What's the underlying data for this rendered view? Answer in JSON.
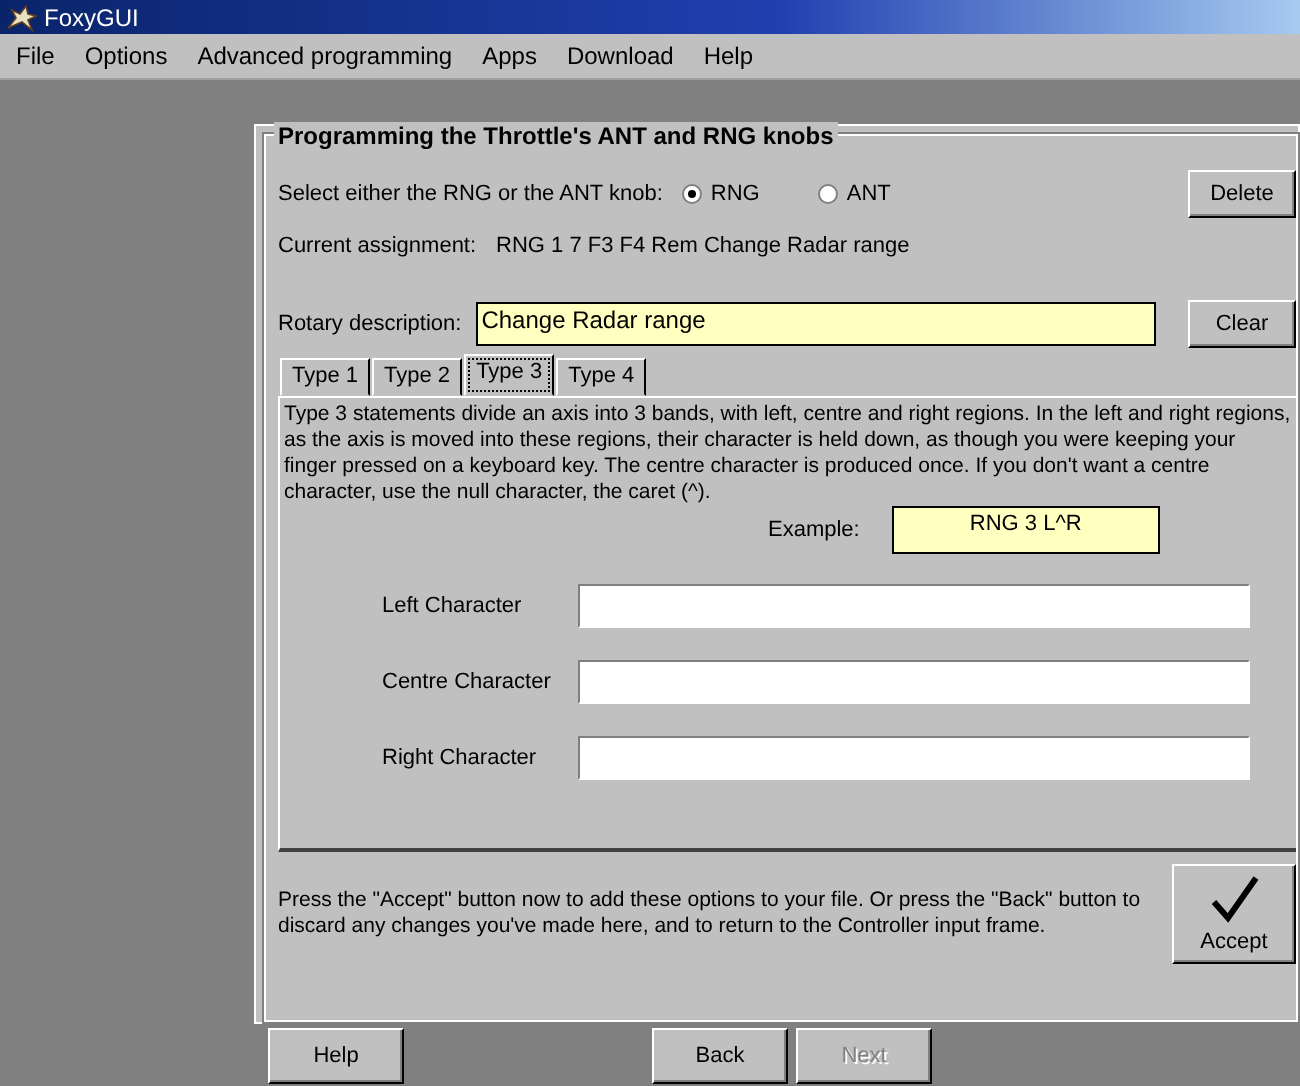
{
  "window": {
    "title": "FoxyGUI"
  },
  "menu": [
    "File",
    "Options",
    "Advanced programming",
    "Apps",
    "Download",
    "Help"
  ],
  "group": {
    "title": "Programming the Throttle's ANT and RNG knobs"
  },
  "knob_select": {
    "label": "Select either the RNG or the ANT knob:",
    "options": [
      {
        "label": "RNG",
        "selected": true
      },
      {
        "label": "ANT",
        "selected": false
      }
    ]
  },
  "delete_button": "Delete",
  "assignment": {
    "label": "Current assignment:",
    "value": "RNG 1 7 F3 F4  Rem Change Radar range"
  },
  "rotary": {
    "label": "Rotary description:",
    "value": "Change Radar range"
  },
  "clear_button": "Clear",
  "tabs": [
    {
      "label": "Type 1",
      "selected": false
    },
    {
      "label": "Type 2",
      "selected": false
    },
    {
      "label": "Type 3",
      "selected": true
    },
    {
      "label": "Type 4",
      "selected": false
    }
  ],
  "description": "Type 3 statements divide an axis into 3 bands, with left, centre and right regions. In the left and right regions, as the axis is moved into these regions, their character is held down, as though you were keeping your finger pressed on a keyboard key. The centre character is produced once. If you don't want a centre character, use the null character, the caret (^).",
  "example": {
    "label": "Example:",
    "value": "RNG 3  L^R"
  },
  "fields": [
    {
      "label": "Left Character"
    },
    {
      "label": "Centre Character"
    },
    {
      "label": "Right Character"
    }
  ],
  "note": "Press the \"Accept\" button now to add these options to your file.  Or press the \"Back\" button to discard any changes you've made here, and to return to the Controller input frame.",
  "accept_button": "Accept",
  "bottom_buttons": [
    {
      "label": "Help",
      "disabled": false
    },
    {
      "label": "Back",
      "disabled": false
    },
    {
      "label": "Next",
      "disabled": true
    }
  ]
}
